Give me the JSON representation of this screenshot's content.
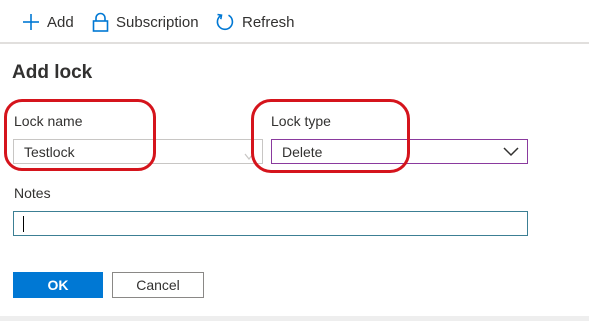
{
  "toolbar": {
    "add_label": "Add",
    "add_icon": "plus-icon",
    "subscription_label": "Subscription",
    "subscription_icon": "lock-icon",
    "refresh_label": "Refresh",
    "refresh_icon": "refresh-icon",
    "icon_color": "#0078d4"
  },
  "panel": {
    "title": "Add lock"
  },
  "form": {
    "lock_name": {
      "label": "Lock name",
      "value": "Testlock"
    },
    "lock_type": {
      "label": "Lock type",
      "selected": "Delete",
      "icon": "chevron-down-icon"
    },
    "notes": {
      "label": "Notes",
      "value": ""
    }
  },
  "actions": {
    "ok_label": "OK",
    "cancel_label": "Cancel",
    "primary_color": "#0078d4"
  },
  "annotation": {
    "highlight_color": "#d5141c"
  }
}
